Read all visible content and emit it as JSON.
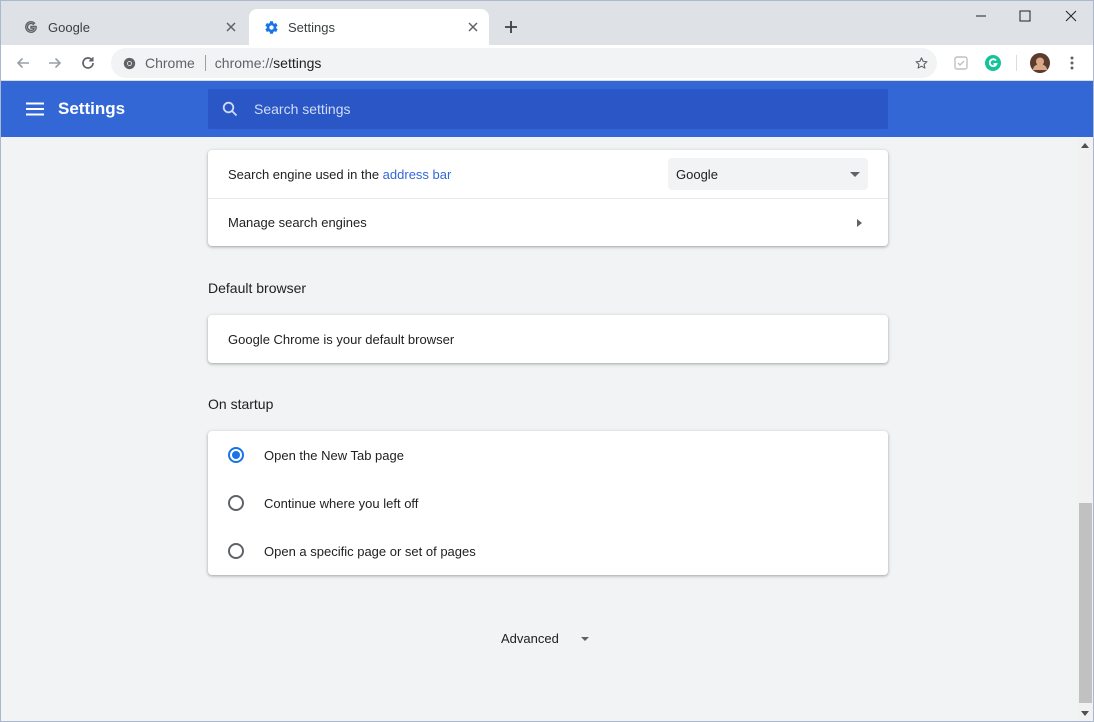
{
  "tabs": [
    {
      "title": "Google",
      "icon": "google-g-icon"
    },
    {
      "title": "Settings",
      "icon": "settings-gear-icon"
    }
  ],
  "toolbar": {
    "omnibox_chip": "Chrome",
    "url_scheme": "chrome://",
    "url_path": "settings"
  },
  "header": {
    "title": "Settings",
    "search_placeholder": "Search settings"
  },
  "search_engine": {
    "label_prefix": "Search engine used in the ",
    "label_link": "address bar",
    "selected": "Google",
    "manage_label": "Manage search engines"
  },
  "default_browser": {
    "heading": "Default browser",
    "status": "Google Chrome is your default browser"
  },
  "startup": {
    "heading": "On startup",
    "options": [
      {
        "label": "Open the New Tab page",
        "checked": true
      },
      {
        "label": "Continue where you left off",
        "checked": false
      },
      {
        "label": "Open a specific page or set of pages",
        "checked": false
      }
    ]
  },
  "advanced_label": "Advanced",
  "colors": {
    "header_blue": "#3367d6",
    "search_box": "#2a56c6",
    "link": "#3367d6",
    "radio_checked": "#1a73e8"
  }
}
